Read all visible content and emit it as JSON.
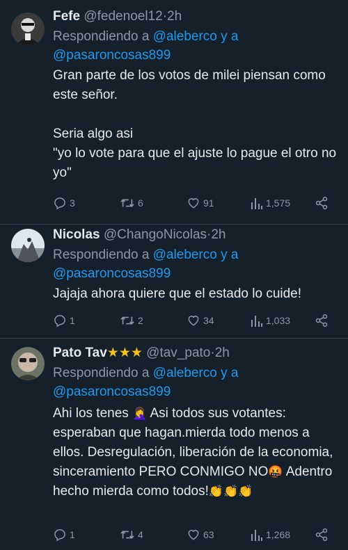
{
  "tweets": [
    {
      "name": "Fefe",
      "handle": "@fedenoel12",
      "dot": "·",
      "time": "2h",
      "reply_prefix": "Respondiendo a",
      "mention1": "@aleberco",
      "reply_and": "y a",
      "mention2": "@pasaroncosas899",
      "text": "Gran parte de los votos de milei piensan como este señor.\n\nSeria algo asi\n\"yo lo vote para que el ajuste lo pague el otro no yo\"",
      "replies": "3",
      "retweets": "6",
      "likes": "91",
      "views": "1,575"
    },
    {
      "name": "Nicolas",
      "handle": "@ChangoNicolas",
      "dot": "·",
      "time": "2h",
      "reply_prefix": "Respondiendo a",
      "mention1": "@aleberco",
      "reply_and": "y a",
      "mention2": "@pasaroncosas899",
      "text": "Jajaja ahora quiere que el estado lo cuide!",
      "replies": "1",
      "retweets": "2",
      "likes": "34",
      "views": "1,033"
    },
    {
      "name": "Pato Tav",
      "name_stars": "★★★",
      "handle": "@tav_pato",
      "dot": "·",
      "time": "2h",
      "reply_prefix": "Respondiendo a",
      "mention1": "@aleberco",
      "reply_and": "y a",
      "mention2": "@pasaroncosas899",
      "text_part1": "Ahi los tenes",
      "emoji_facepalm": "🤦‍♀️",
      "text_part2": " Asi todos sus votantes: esperaban que hagan.mierda todo menos a ellos. Desregulación, liberación de la economia, sinceramiento PERO CONMIGO NO",
      "emoji_angry": "🤬",
      "text_part3": " Adentro hecho mierda como todos!",
      "emoji_clap": "👏👏👏",
      "replies": "1",
      "retweets": "4",
      "likes": "63",
      "views": "1,268"
    }
  ],
  "colors": {
    "background": "#15202b",
    "text": "#e7e9ea",
    "muted": "#8b98a5",
    "link": "#1d9bf0",
    "divider": "#38444d"
  }
}
